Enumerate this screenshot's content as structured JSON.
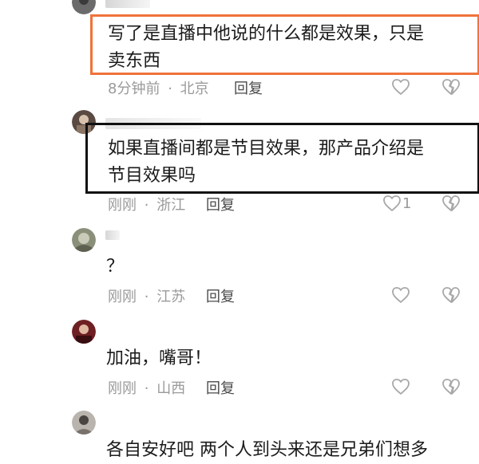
{
  "comments": [
    {
      "content_line1": "写了是直播中他说的什么都是效果，只是",
      "content_line2": "卖东西",
      "time": "8分钟前",
      "location": "北京",
      "reply_label": "回复",
      "like_count": "",
      "highlight_color": "#f0723a"
    },
    {
      "content_line1": "如果直播间都是节目效果，那产品介绍是",
      "content_line2": "节目效果吗",
      "time": "刚刚",
      "location": "浙江",
      "reply_label": "回复",
      "like_count": "1",
      "highlight_color": "#111111"
    },
    {
      "content_line1": "？",
      "time": "刚刚",
      "location": "江苏",
      "reply_label": "回复",
      "like_count": ""
    },
    {
      "content_line1": "加油，嘴哥！",
      "time": "刚刚",
      "location": "山西",
      "reply_label": "回复",
      "like_count": ""
    },
    {
      "content_line1": "各自安好吧 两个人到头来还是兄弟们想多"
    }
  ],
  "meta_separator": "·",
  "icons": [
    "heart-outline-icon",
    "broken-heart-icon"
  ]
}
